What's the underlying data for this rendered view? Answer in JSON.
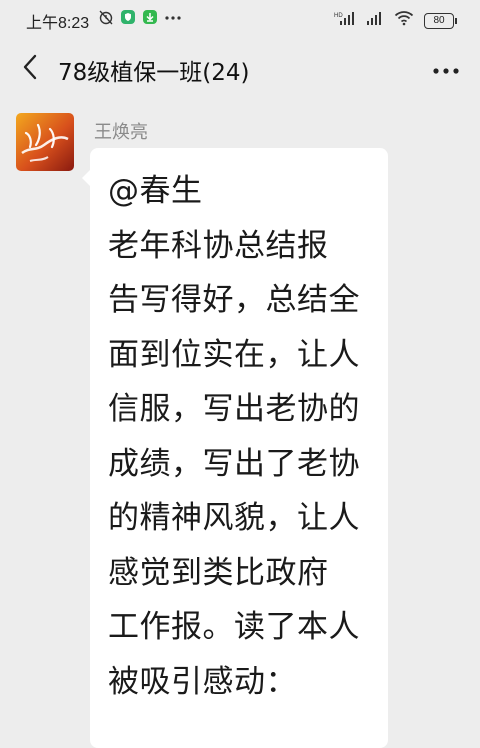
{
  "status_bar": {
    "time": "上午8:23",
    "left_icons": [
      "alarm-off-icon",
      "security-shield-icon",
      "download-icon",
      "more-dots-icon"
    ],
    "right_icons": [
      "signal-hd-icon",
      "signal-icon",
      "wifi-icon"
    ],
    "battery": "80"
  },
  "header": {
    "title": "78级植保一班(24)",
    "back_icon": "chevron-left-icon",
    "menu_icon": "more-horizontal-icon"
  },
  "message": {
    "sender": "王焕亮",
    "lines": [
      "@春生",
      "老年科协总结报",
      "告写得好，总结全",
      "面到位实在，让人",
      "信服，写出老协的",
      "成绩，写出了老协",
      "的精神风貌，让人",
      "感觉到类比政府",
      "工作报。读了本人",
      "被吸引感动："
    ]
  },
  "colors": {
    "background": "#ededed",
    "bubble": "#ffffff",
    "sender_name": "#8a8a8a",
    "text": "#1a1a1a"
  }
}
